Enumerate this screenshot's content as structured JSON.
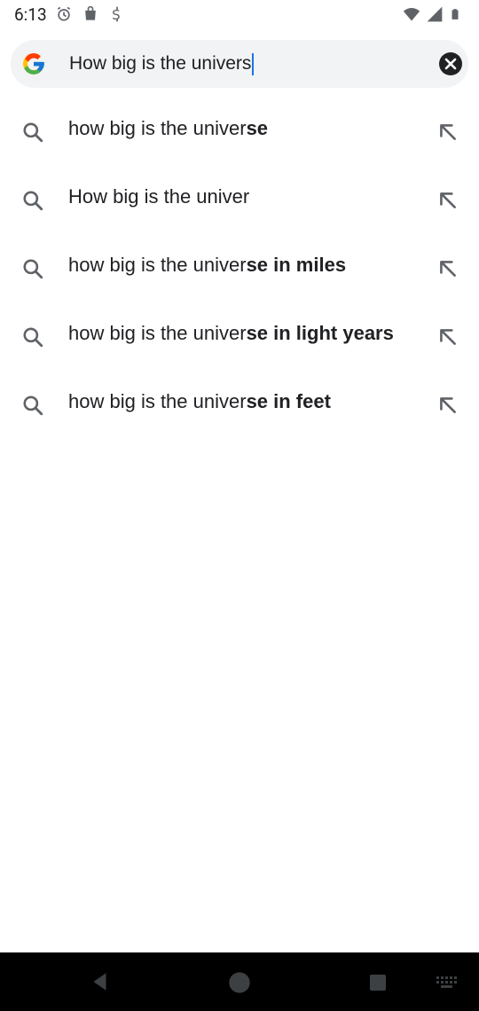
{
  "status_bar": {
    "time": "6:13",
    "icons_left": [
      "alarm-icon",
      "store-icon",
      "sync-icon"
    ],
    "icons_right": [
      "wifi-icon",
      "signal-icon",
      "battery-icon"
    ]
  },
  "search": {
    "query": "How big is the univers",
    "clear_icon": "close-icon"
  },
  "suggestions": [
    {
      "prefix": "how big is the univer",
      "bold": "se"
    },
    {
      "prefix": "How big is the univer",
      "bold": ""
    },
    {
      "prefix": "how big is the univer",
      "bold": "se in miles"
    },
    {
      "prefix": "how big is the univer",
      "bold": "se in light years"
    },
    {
      "prefix": "how big is the univer",
      "bold": "se in feet"
    }
  ],
  "nav_bar": {
    "icons": [
      "back-icon",
      "home-icon",
      "recents-icon",
      "keyboard-icon"
    ]
  },
  "colors": {
    "search_bg": "#f1f3f4",
    "caret": "#1a73e8",
    "nav_bg": "#000000",
    "icon_gray": "#5f6368"
  }
}
